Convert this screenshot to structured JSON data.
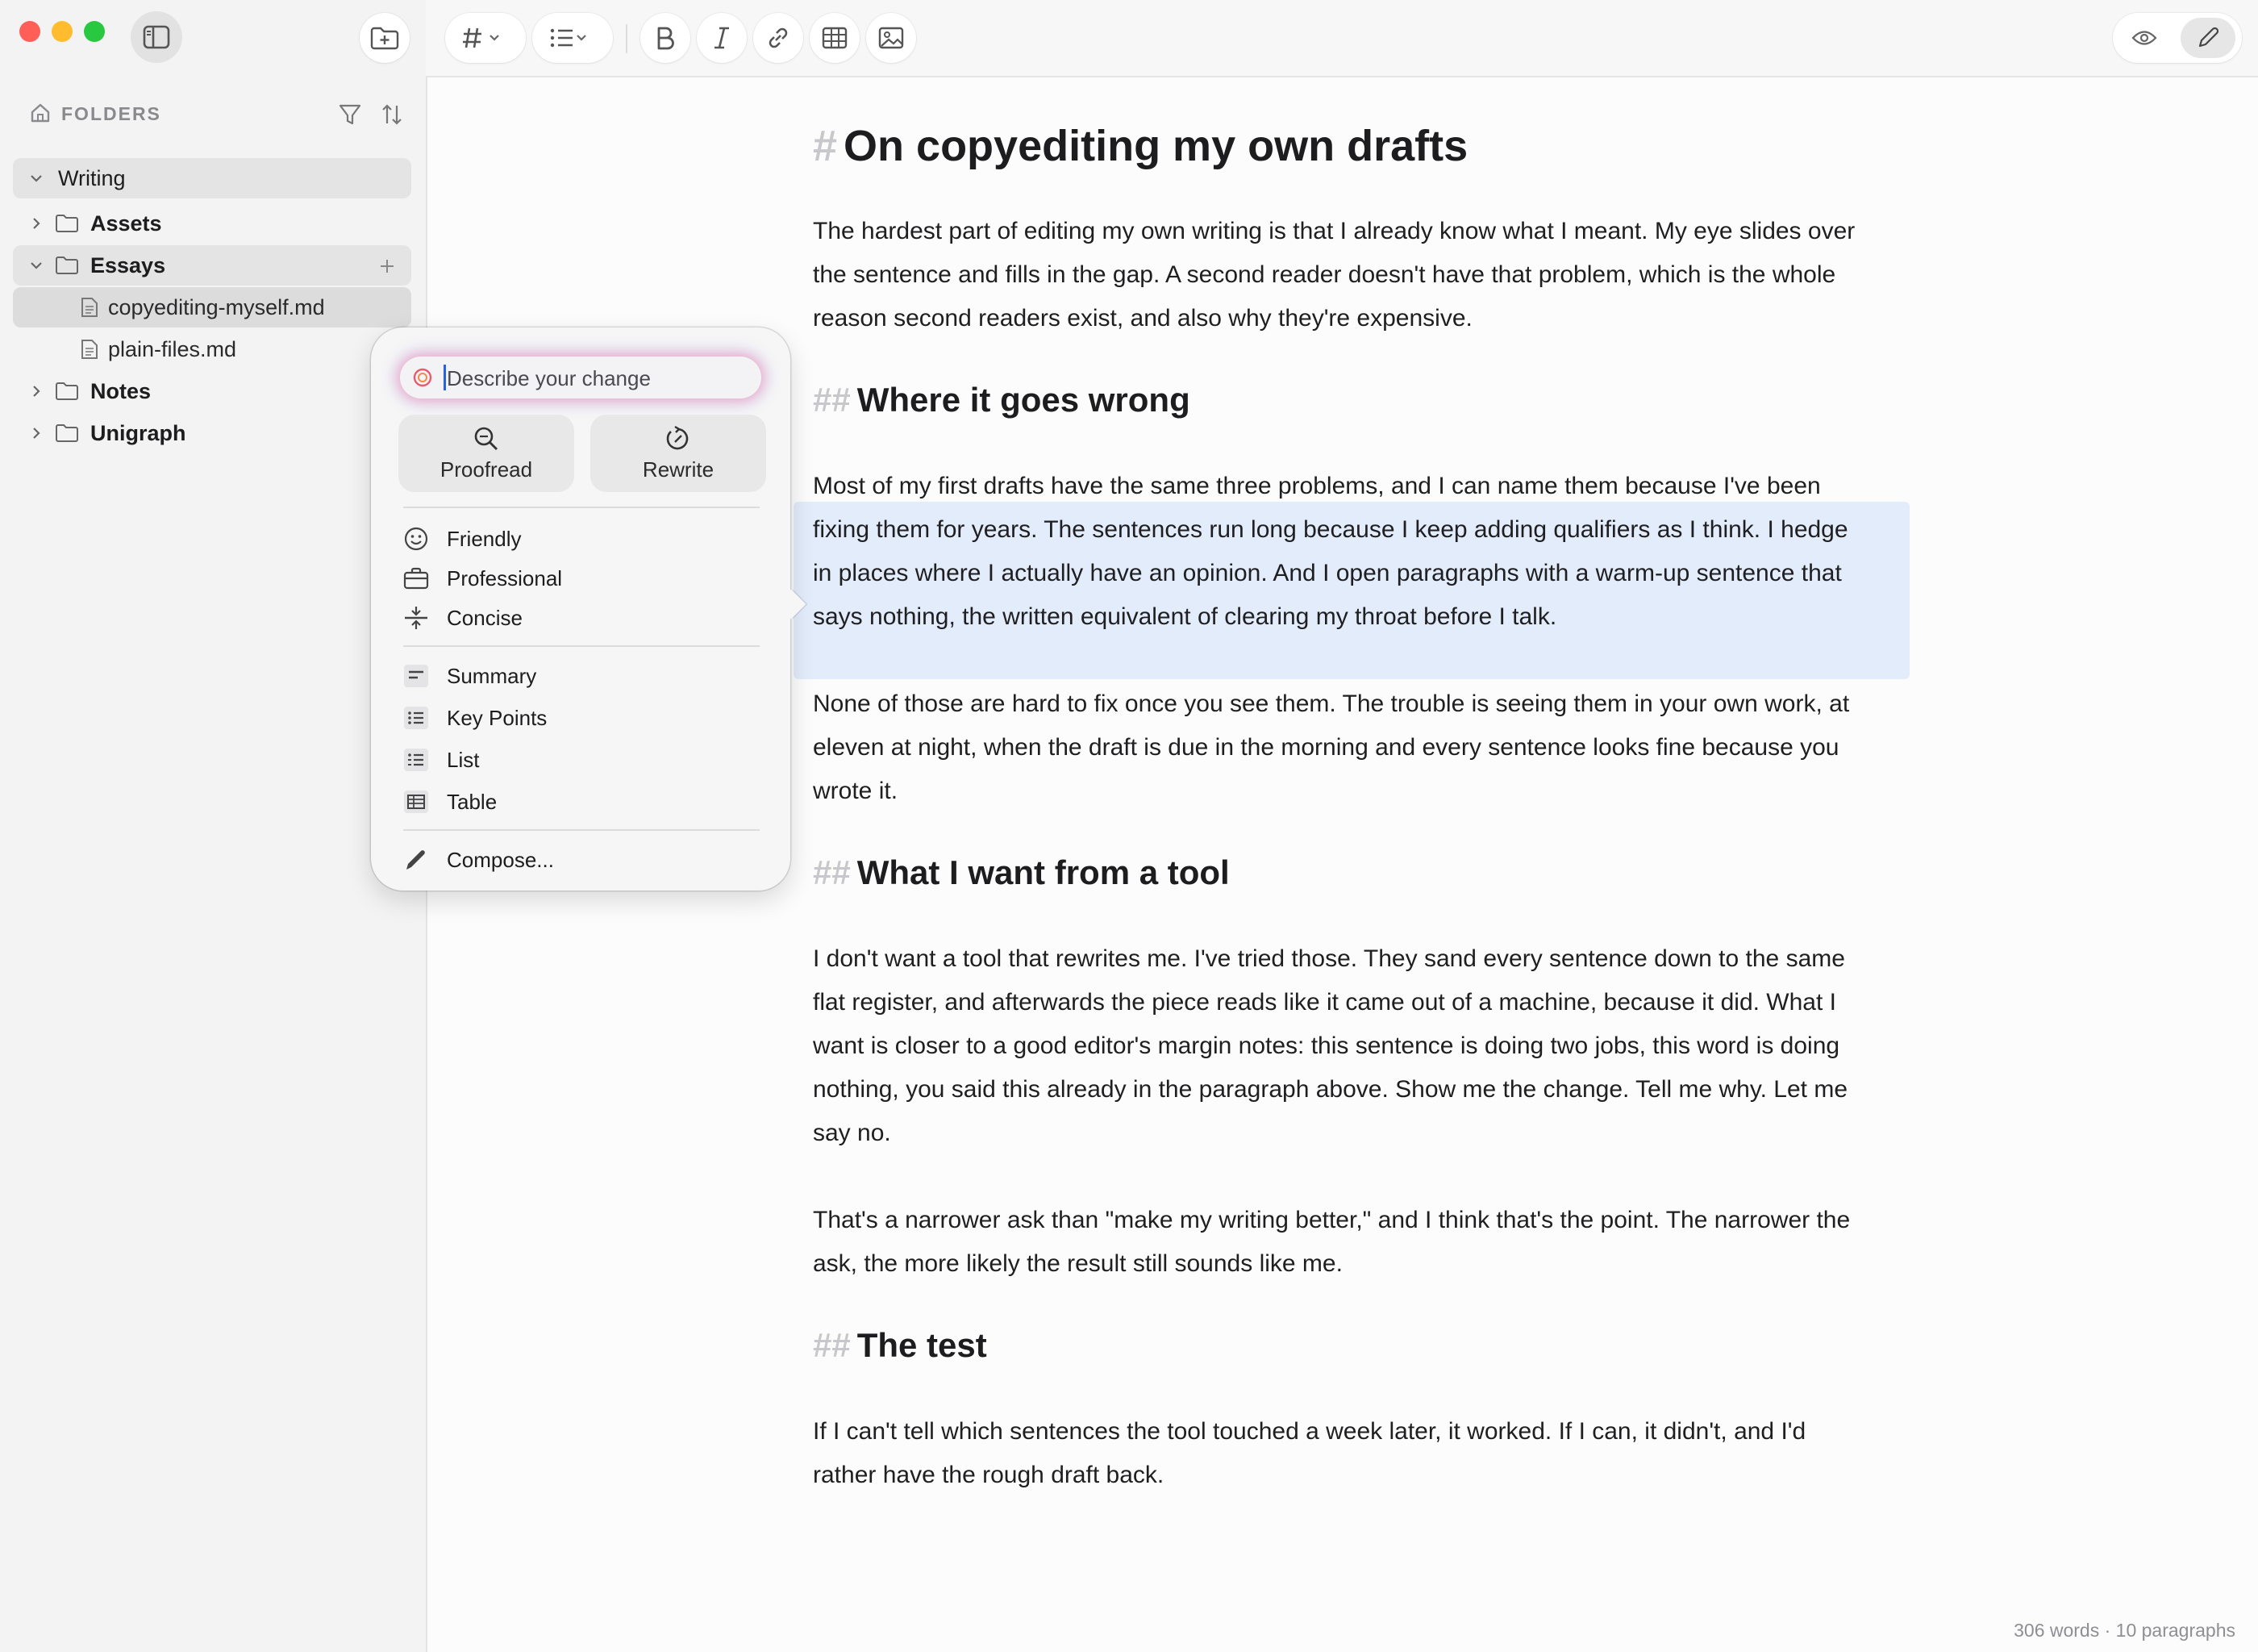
{
  "sidebar": {
    "section_label": "FOLDERS",
    "tree": {
      "root": "Writing",
      "assets": "Assets",
      "essays": "Essays",
      "file1": "copyediting-myself.md",
      "file2": "plain-files.md",
      "notes": "Notes",
      "unigraph": "Unigraph"
    }
  },
  "popup": {
    "input_placeholder": "Describe your change",
    "proofread": "Proofread",
    "rewrite": "Rewrite",
    "tones": [
      "Friendly",
      "Professional",
      "Concise"
    ],
    "formats": [
      "Summary",
      "Key Points",
      "List",
      "Table"
    ],
    "compose": "Compose..."
  },
  "doc": {
    "h1_hash": "#",
    "h2_hash": "##",
    "title": "On copyediting my own drafts",
    "p1": "The hardest part of editing my own writing is that I already know what I meant. My eye slides over the sentence and fills in the gap. A second reader doesn't have that problem, which is the whole reason second readers exist, and also why they're expensive.",
    "h2a": "Where it goes wrong",
    "p2": "Most of my first drafts have the same three problems, and I can name them because I've been fixing them for years. The sentences run long because I keep adding qualifiers as I think. I hedge in places where I actually have an opinion. And I open paragraphs with a warm-up sentence that says nothing, the written equivalent of clearing my throat before I talk.",
    "p3": "None of those are hard to fix once you see them. The trouble is seeing them in your own work, at eleven at night, when the draft is due in the morning and every sentence looks fine because you wrote it.",
    "h2b": "What I want from a tool",
    "p4": "I don't want a tool that rewrites me. I've tried those. They sand every sentence down to the same flat register, and afterwards the piece reads like it came out of a machine, because it did. What I want is closer to a good editor's margin notes: this sentence is doing two jobs, this word is doing nothing, you said this already in the paragraph above. Show me the change. Tell me why. Let me say no.",
    "p5": "That's a narrower ask than \"make my writing better,\" and I think that's the point. The narrower the ask, the more likely the result still sounds like me.",
    "h2c": "The test",
    "p6": "If I can't tell which sentences the tool touched a week later, it worked. If I can, it didn't, and I'd rather have the rough draft back."
  },
  "status": {
    "counts": "306 words · 10 paragraphs"
  },
  "colors": {
    "close": "#ff5f57",
    "minimize": "#febc2e",
    "zoom": "#28c840",
    "selection": "#dde9fb"
  }
}
